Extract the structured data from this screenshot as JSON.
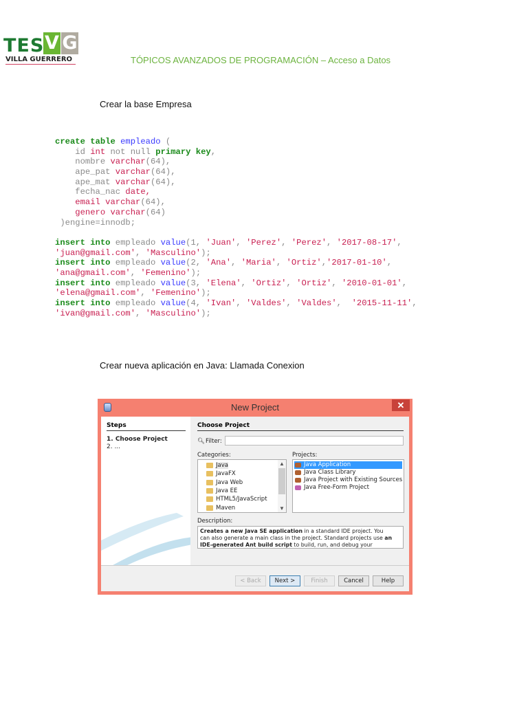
{
  "header": {
    "logo_text": "TESVG",
    "logo_sub": "VILLA GUERRERO",
    "title": "TÓPICOS AVANZADOS DE PROGRAMACIÓN – Acceso a Datos"
  },
  "intro": "Crear la base Empresa",
  "code_lines": [
    [
      [
        "kw",
        "create table "
      ],
      [
        "id",
        "empleado"
      ],
      [
        "pl",
        " ("
      ]
    ],
    [
      [
        "pl",
        "    id "
      ],
      [
        "ty",
        "int"
      ],
      [
        "pl",
        " not null "
      ],
      [
        "kw",
        "primary key"
      ],
      [
        "pl",
        ","
      ]
    ],
    [
      [
        "pl",
        "    nombre "
      ],
      [
        "ty",
        "varchar"
      ],
      [
        "pl",
        "(64),"
      ]
    ],
    [
      [
        "pl",
        "    ape_pat "
      ],
      [
        "ty",
        "varchar"
      ],
      [
        "pl",
        "(64),"
      ]
    ],
    [
      [
        "pl",
        "    ape_mat "
      ],
      [
        "ty",
        "varchar"
      ],
      [
        "pl",
        "(64),"
      ]
    ],
    [
      [
        "pl",
        "    fecha_nac "
      ],
      [
        "ty",
        "date,"
      ]
    ],
    [
      [
        "pl",
        "    "
      ],
      [
        "ty",
        "email varchar"
      ],
      [
        "pl",
        "(64),"
      ]
    ],
    [
      [
        "pl",
        "    "
      ],
      [
        "ty",
        "genero varchar"
      ],
      [
        "pl",
        "(64)"
      ]
    ],
    [
      [
        "pl",
        " )engine=innodb;"
      ]
    ],
    [
      [
        "pl",
        ""
      ]
    ],
    [
      [
        "kw",
        "insert into"
      ],
      [
        "pl",
        " empleado "
      ],
      [
        "id",
        "value"
      ],
      [
        "pl",
        "(1, "
      ],
      [
        "st",
        "'Juan'"
      ],
      [
        "pl",
        ", "
      ],
      [
        "st",
        "'Perez'"
      ],
      [
        "pl",
        ", "
      ],
      [
        "st",
        "'Perez'"
      ],
      [
        "pl",
        ", "
      ],
      [
        "st",
        "'2017-08-17'"
      ],
      [
        "pl",
        ","
      ]
    ],
    [
      [
        "st",
        "'juan@gmail.com'"
      ],
      [
        "pl",
        ", "
      ],
      [
        "st",
        "'Masculino'"
      ],
      [
        "pl",
        ");"
      ]
    ],
    [
      [
        "kw",
        "insert into"
      ],
      [
        "pl",
        " empleado "
      ],
      [
        "id",
        "value"
      ],
      [
        "pl",
        "(2, "
      ],
      [
        "st",
        "'Ana'"
      ],
      [
        "pl",
        ", "
      ],
      [
        "st",
        "'Maria'"
      ],
      [
        "pl",
        ", "
      ],
      [
        "st",
        "'Ortiz'"
      ],
      [
        "pl",
        ","
      ],
      [
        "st",
        "'2017-01-10'"
      ],
      [
        "pl",
        ","
      ]
    ],
    [
      [
        "st",
        "'ana@gmail.com'"
      ],
      [
        "pl",
        ", "
      ],
      [
        "st",
        "'Femenino'"
      ],
      [
        "pl",
        ");"
      ]
    ],
    [
      [
        "kw",
        "insert into"
      ],
      [
        "pl",
        " empleado "
      ],
      [
        "id",
        "value"
      ],
      [
        "pl",
        "(3, "
      ],
      [
        "st",
        "'Elena'"
      ],
      [
        "pl",
        ", "
      ],
      [
        "st",
        "'Ortiz'"
      ],
      [
        "pl",
        ", "
      ],
      [
        "st",
        "'Ortiz'"
      ],
      [
        "pl",
        ", "
      ],
      [
        "st",
        "'2010-01-01'"
      ],
      [
        "pl",
        ","
      ]
    ],
    [
      [
        "st",
        "'elena@gmail.com'"
      ],
      [
        "pl",
        ", "
      ],
      [
        "st",
        "'Femenino'"
      ],
      [
        "pl",
        ");"
      ]
    ],
    [
      [
        "kw",
        "insert into"
      ],
      [
        "pl",
        " empleado "
      ],
      [
        "id",
        "value"
      ],
      [
        "pl",
        "(4, "
      ],
      [
        "st",
        "'Ivan'"
      ],
      [
        "pl",
        ", "
      ],
      [
        "st",
        "'Valdes'"
      ],
      [
        "pl",
        ", "
      ],
      [
        "st",
        "'Valdes'"
      ],
      [
        "pl",
        ",  "
      ],
      [
        "st",
        "'2015-11-11'"
      ],
      [
        "pl",
        ","
      ]
    ],
    [
      [
        "st",
        "'ivan@gmail.com'"
      ],
      [
        "pl",
        ", "
      ],
      [
        "st",
        "'Masculino'"
      ],
      [
        "pl",
        ");"
      ]
    ]
  ],
  "section2": "Crear nueva aplicación en Java: Llamada Conexion",
  "dialog": {
    "title": "New Project",
    "close": "✕",
    "steps_header": "Steps",
    "steps": [
      "1.   Choose Project",
      "2.   ..."
    ],
    "main_header": "Choose Project",
    "filter_label": "Filter:",
    "filter_value": "",
    "categories_label": "Categories:",
    "categories": [
      "Java",
      "JavaFX",
      "Java Web",
      "Java EE",
      "HTML5/JavaScript",
      "Maven"
    ],
    "projects_label": "Projects:",
    "projects": [
      "Java Application",
      "Java Class Library",
      "Java Project with Existing Sources",
      "Java Free-Form Project"
    ],
    "description_label": "Description:",
    "description": {
      "b1": "Creates a new Java SE application",
      "t1": " in a standard IDE project. You can also generate a main class in the project. Standard projects use ",
      "b2": "an IDE-generated Ant build script",
      "t2": " to build, run, and debug your project."
    },
    "buttons": {
      "back": "< Back",
      "next": "Next >",
      "finish": "Finish",
      "cancel": "Cancel",
      "help": "Help"
    }
  }
}
